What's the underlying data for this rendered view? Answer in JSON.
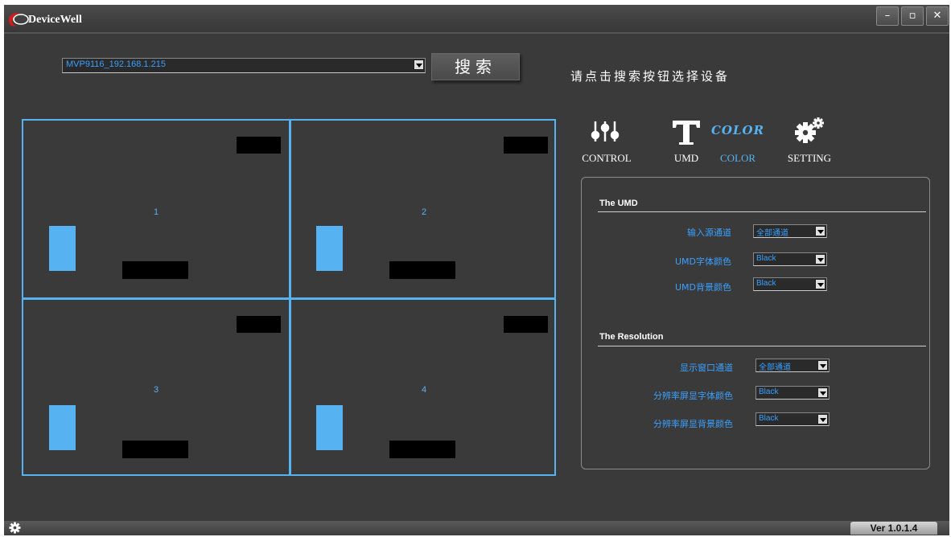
{
  "window": {
    "title": "DeviceWell",
    "minimize_symbol": "–",
    "restore_symbol": "▫",
    "close_symbol": "✕"
  },
  "device": {
    "selected": "MVP9116_192.168.1.215"
  },
  "search_label": "搜索",
  "hint": "请点击搜索按钮选择设备",
  "preview": {
    "cells": [
      {
        "number": "1"
      },
      {
        "number": "2"
      },
      {
        "number": "3"
      },
      {
        "number": "4"
      }
    ],
    "accent_color": "#56b2f0"
  },
  "tabs": [
    {
      "label": "CONTROL",
      "icon": "sliders-icon"
    },
    {
      "label": "UMD",
      "icon": "text-t-icon"
    },
    {
      "label": "COLOR",
      "icon": "color-icon",
      "icon_text": "COLOR",
      "active": true
    },
    {
      "label": "SETTING",
      "icon": "gears-icon"
    }
  ],
  "umd": {
    "title": "The UMD",
    "rows": [
      {
        "label": "输入源通道",
        "value": "全部通道"
      },
      {
        "label": "UMD字体颜色",
        "value": "Black"
      },
      {
        "label": "UMD背景颜色",
        "value": "Black"
      }
    ]
  },
  "resolution": {
    "title": "The Resolution",
    "rows": [
      {
        "label": "显示窗口通道",
        "value": "全部通道"
      },
      {
        "label": "分辨率屏显字体颜色",
        "value": "Black"
      },
      {
        "label": "分辨率屏显背景颜色",
        "value": "Black"
      }
    ]
  },
  "version": "Ver 1.0.1.4"
}
